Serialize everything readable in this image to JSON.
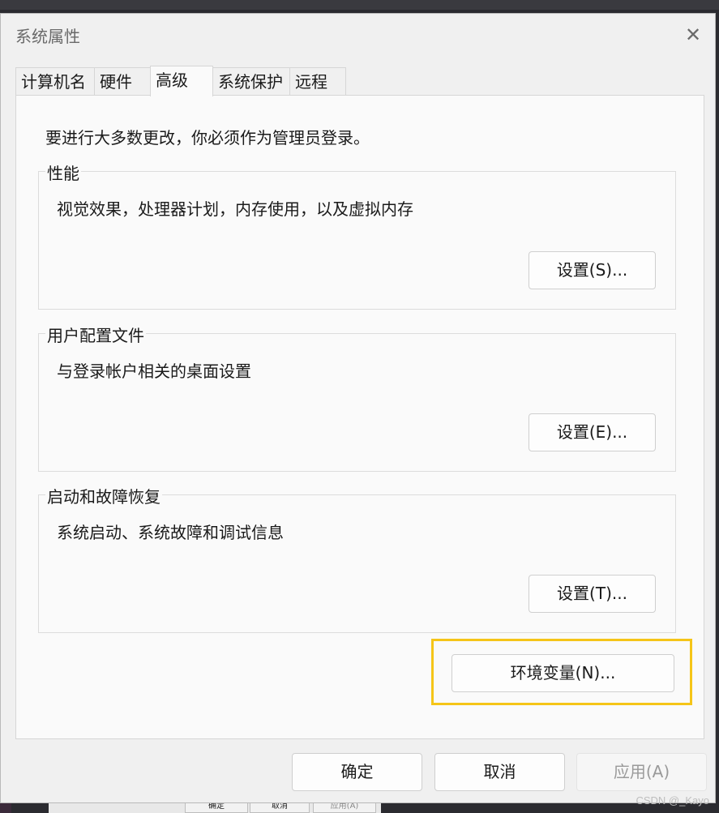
{
  "window": {
    "title": "系统属性",
    "close_glyph": "✕"
  },
  "tabs": [
    {
      "label": "计算机名",
      "active": false
    },
    {
      "label": "硬件",
      "active": false
    },
    {
      "label": "高级",
      "active": true
    },
    {
      "label": "系统保护",
      "active": false
    },
    {
      "label": "远程",
      "active": false
    }
  ],
  "advanced": {
    "intro": "要进行大多数更改，你必须作为管理员登录。",
    "performance": {
      "title": "性能",
      "description": "视觉效果，处理器计划，内存使用，以及虚拟内存",
      "button": "设置(S)..."
    },
    "user_profiles": {
      "title": "用户配置文件",
      "description": "与登录帐户相关的桌面设置",
      "button": "设置(E)..."
    },
    "startup_recovery": {
      "title": "启动和故障恢复",
      "description": "系统启动、系统故障和调试信息",
      "button": "设置(T)..."
    },
    "env_button": "环境变量(N)...",
    "highlight_color": "#f5c518"
  },
  "footer": {
    "ok": "确定",
    "cancel": "取消",
    "apply": "应用(A)",
    "apply_enabled": false
  },
  "background": {
    "ok": "确定",
    "cancel": "取消",
    "apply": "应用(A)"
  },
  "watermark": "CSDN @_Kayo"
}
